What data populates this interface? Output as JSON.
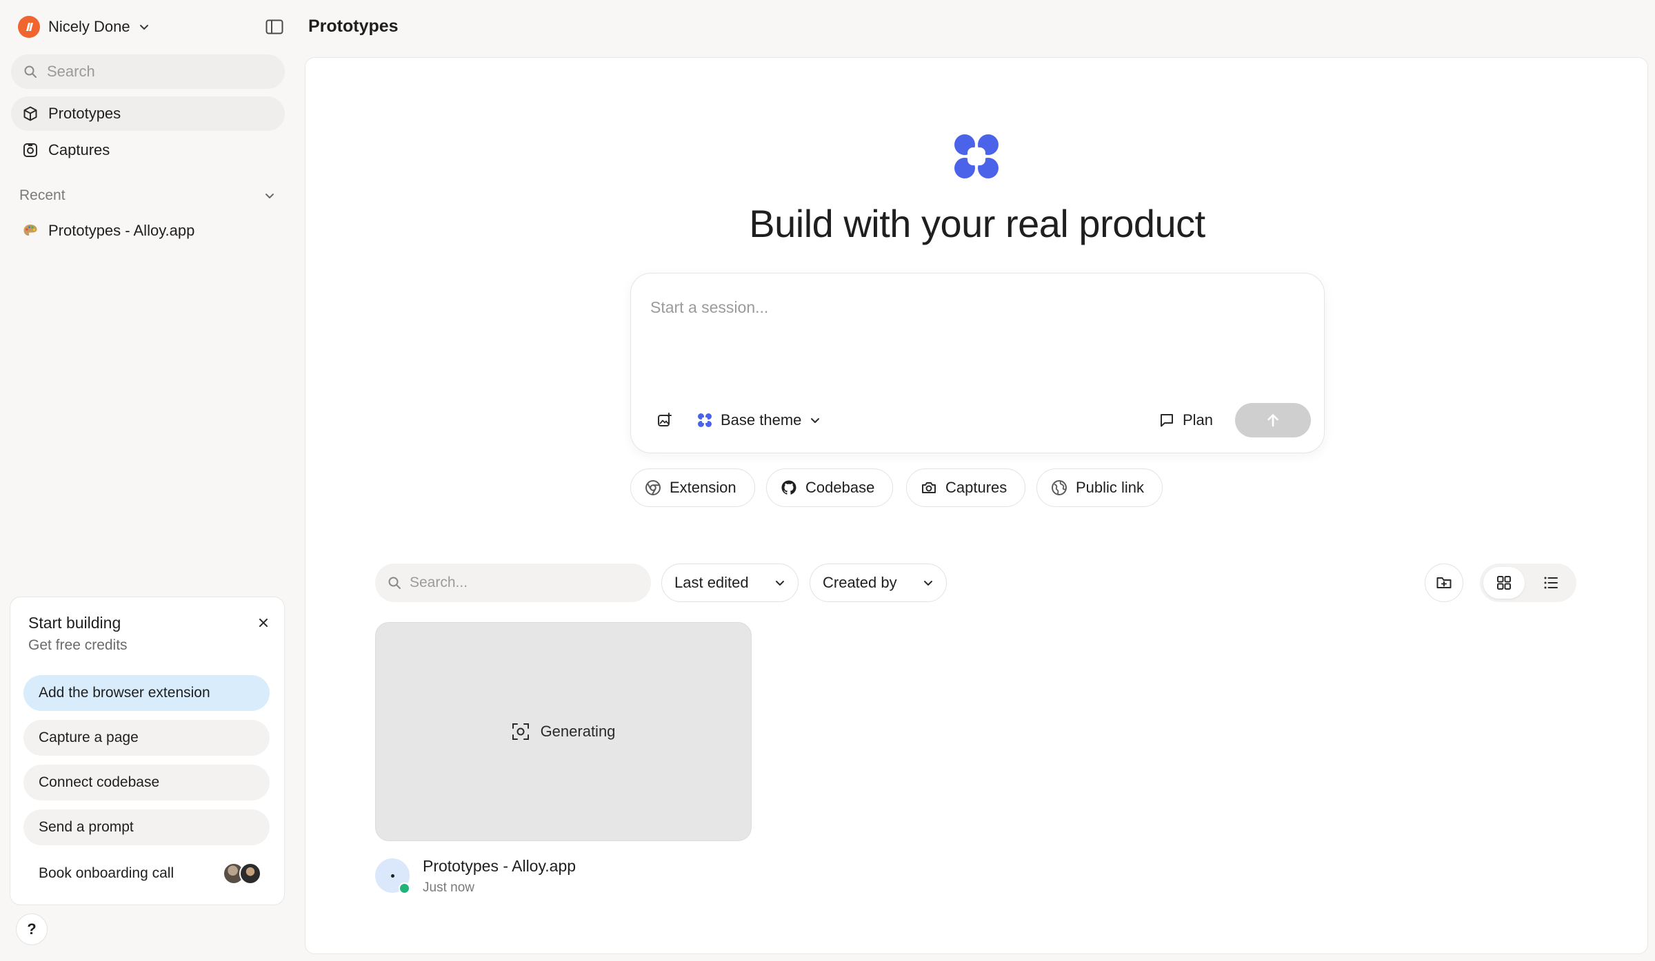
{
  "workspace": {
    "name": "Nicely Done"
  },
  "sidebar": {
    "search_placeholder": "Search",
    "nav": [
      {
        "label": "Prototypes",
        "icon": "cube-icon",
        "active": true
      },
      {
        "label": "Captures",
        "icon": "camera-icon",
        "active": false
      }
    ],
    "recent_label": "Recent",
    "recent_items": [
      {
        "label": "Prototypes - Alloy.app",
        "icon": "palette-icon"
      }
    ]
  },
  "onboarding": {
    "title": "Start building",
    "subtitle": "Get free credits",
    "steps": [
      "Add the browser extension",
      "Capture a page",
      "Connect codebase",
      "Send a prompt",
      "Book onboarding call"
    ]
  },
  "help_label": "?",
  "header": {
    "title": "Prototypes"
  },
  "hero": {
    "title": "Build with your real product"
  },
  "composer": {
    "placeholder": "Start a session...",
    "theme_label": "Base theme",
    "plan_label": "Plan"
  },
  "sources": [
    "Extension",
    "Codebase",
    "Captures",
    "Public link"
  ],
  "toolbar": {
    "search_placeholder": "Search...",
    "sort_label": "Last edited",
    "creator_label": "Created by"
  },
  "project": {
    "status": "Generating",
    "name": "Prototypes - Alloy.app",
    "time": "Just now"
  },
  "colors": {
    "brand_blue": "#4a63e8",
    "workspace_orange": "#f0652f",
    "online_green": "#1fb57a",
    "primary_step_bg": "#d8ecfc"
  }
}
